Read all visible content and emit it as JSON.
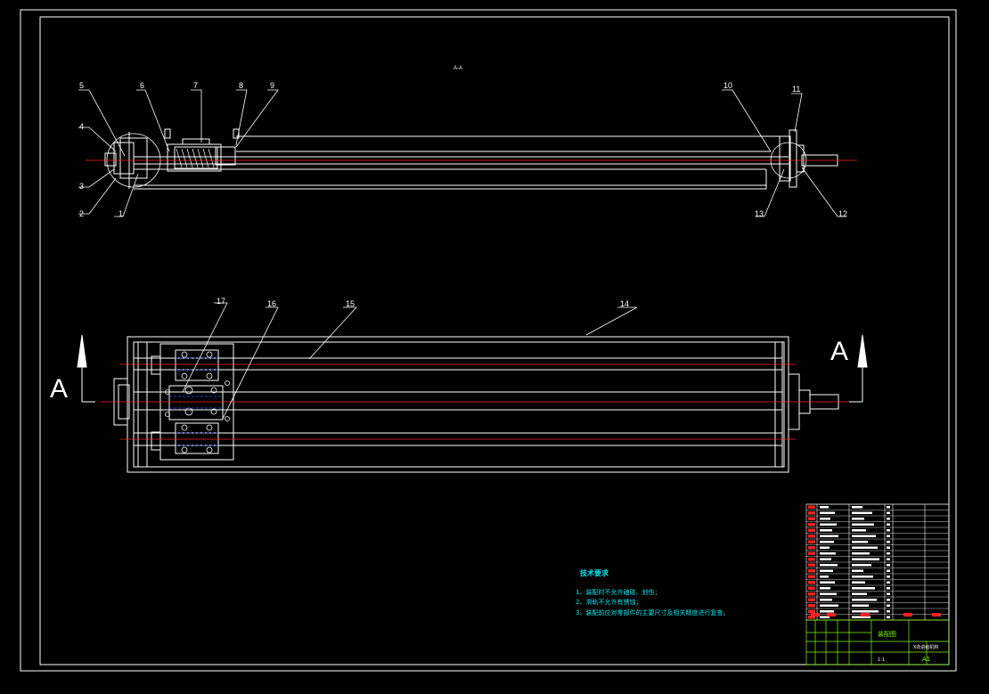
{
  "section_title": "A-A",
  "view_letter_left": "A",
  "view_letter_right": "A",
  "callouts_top": [
    "1",
    "2",
    "3",
    "4",
    "5",
    "6",
    "7",
    "8",
    "9",
    "10",
    "11",
    "12",
    "13"
  ],
  "callouts_bottom": [
    "14",
    "15",
    "16",
    "17"
  ],
  "technical_requirements": {
    "heading": "技术要求",
    "items": [
      "1、装配时不允许磕碰、划伤；",
      "2、滑轨不允许有锈蚀；",
      "3、装配前应对零部件的主要尺寸及相关精度进行复查。"
    ]
  },
  "title_block": {
    "drawing_name": "装配图",
    "part_name": "X向进给机构",
    "scale": "1:1",
    "sheet": "A1"
  },
  "colors": {
    "background": "#000000",
    "lines": "#ffffff",
    "centerline": "#ff2020",
    "hidden": "#3050ff",
    "notes": "#00e5ee",
    "title_block": "#7cfc00",
    "bom_mark": "#ff2020"
  }
}
